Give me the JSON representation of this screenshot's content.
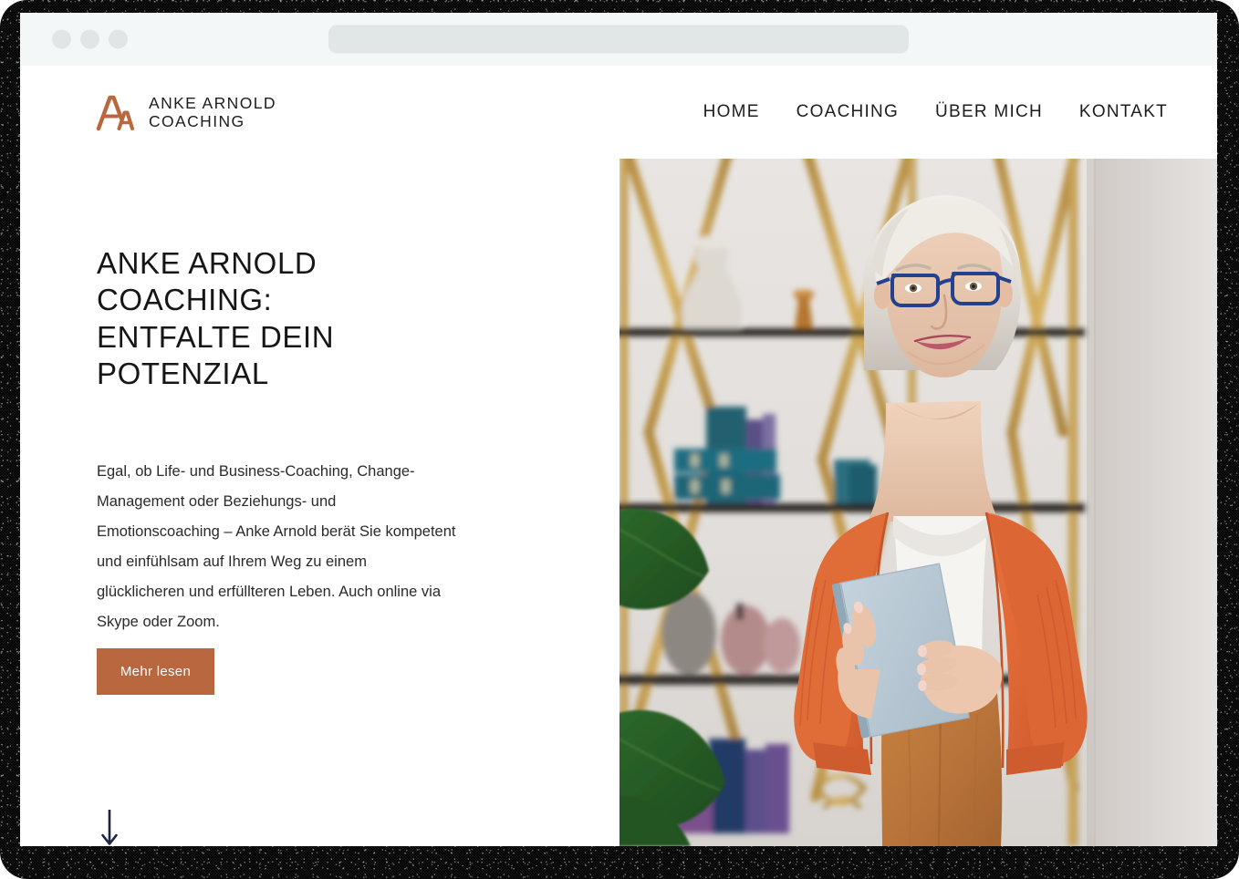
{
  "browser": {
    "traffic_lights": [
      "close",
      "minimize",
      "maximize"
    ],
    "address_value": "",
    "address_placeholder": "",
    "chrome_bg": "#f3f7f8",
    "address_bg": "#e1e6e7"
  },
  "brand": {
    "logo_icon": "aa-monogram-icon",
    "line1": "ANKE ARNOLD",
    "line2": "COACHING",
    "color": "#b9673f"
  },
  "nav": {
    "items": [
      {
        "label": "HOME",
        "name": "nav-link-home"
      },
      {
        "label": "COACHING",
        "name": "nav-link-coaching"
      },
      {
        "label": "ÜBER MICH",
        "name": "nav-link-ueber-mich"
      },
      {
        "label": "KONTAKT",
        "name": "nav-link-kontakt"
      }
    ]
  },
  "hero": {
    "headline": "ANKE ARNOLD COACHING:\nENTFALTE DEIN POTENZIAL",
    "paragraph": "Egal, ob Life- und Business-Coaching, Change-Management oder Beziehungs- und Emotionscoaching – Anke Arnold berät Sie kompetent und einfühlsam auf Ihrem Weg zu einem glücklicheren und erfüllteren Leben. Auch online via Skype oder Zoom.",
    "cta_label": "Mehr lesen",
    "cta_color": "#b9673f",
    "scroll_icon": "arrow-down-icon",
    "scroll_icon_color": "#1d2340",
    "image_alt": "Lächelnde Frau mit weißem Haar und blauer Brille, orangefarbene Strickjacke, hält ein hellblaues Buch vor einem goldenen Regal",
    "accent_color": "#b9673f"
  }
}
